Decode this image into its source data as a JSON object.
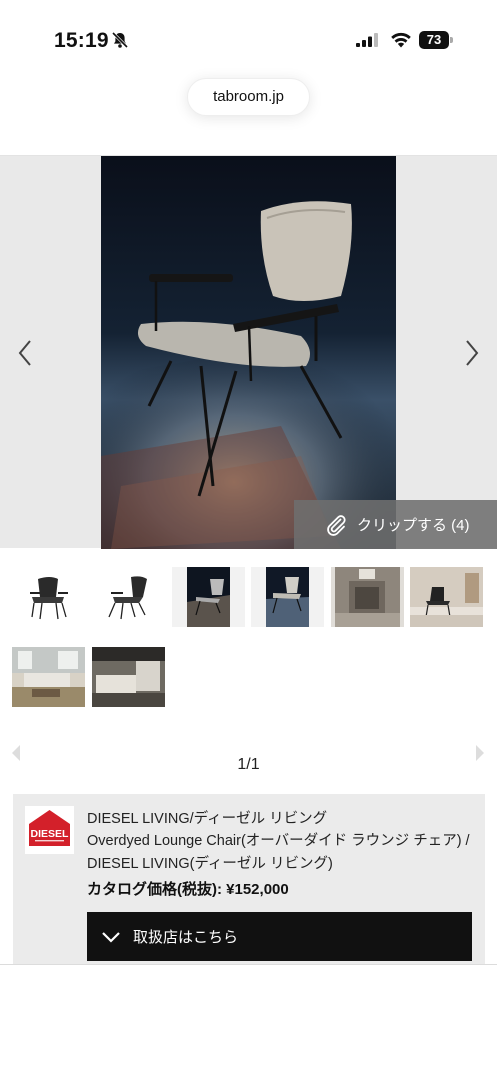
{
  "status_bar": {
    "time": "15:19",
    "battery": "73",
    "icons": [
      "bell-slash-icon",
      "cellular-signal-icon",
      "wifi-icon",
      "battery-icon"
    ]
  },
  "browser": {
    "url": "tabroom.jp"
  },
  "gallery": {
    "clip_label": "クリップする (4)",
    "thumbnail_count": 8,
    "pager": "1/1"
  },
  "product": {
    "brand": "DIESEL LIVING/ディーゼル リビング",
    "name": "Overdyed Lounge Chair(オーバーダイド ラウンジ チェア) / DIESEL LIVING(ディーゼル リビング)",
    "price": "カタログ価格(税抜): ¥152,000",
    "logo_text": "DIESEL",
    "dealer_button": "取扱店はこちら"
  },
  "colors": {
    "logo_red": "#d3202a",
    "button_dark": "#111111",
    "card_bg": "#ebebeb",
    "carousel_bg": "#e9e9e9"
  }
}
